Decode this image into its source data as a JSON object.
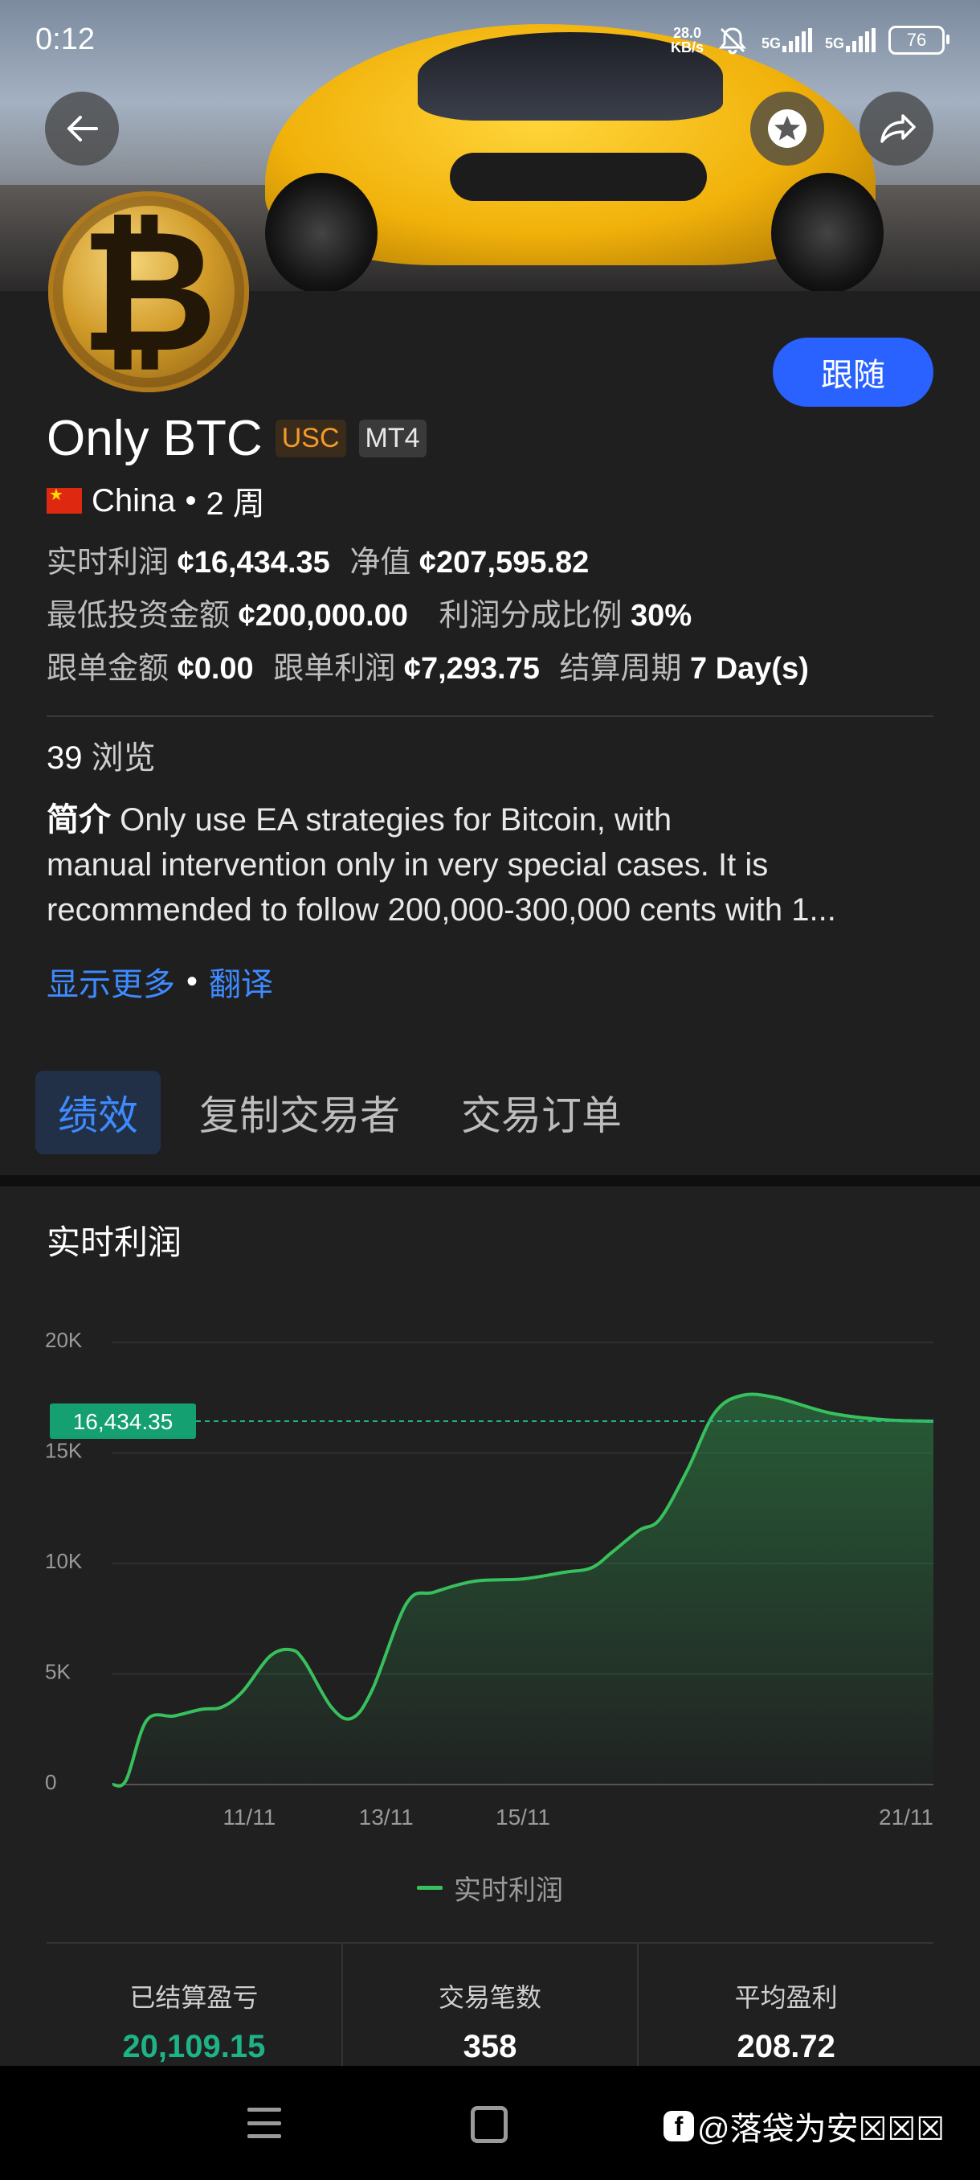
{
  "status_bar": {
    "time": "0:12",
    "net_speed_value": "28.0",
    "net_speed_unit": "KB/s",
    "sim1": "5G",
    "sim2": "5G",
    "battery": "76"
  },
  "header": {
    "icons": [
      "back-arrow-icon",
      "star-icon",
      "share-icon"
    ]
  },
  "profile": {
    "name": "Only BTC",
    "tag_currency": "USC",
    "tag_platform": "MT4",
    "country": "China",
    "separator": "•",
    "duration": "2 周",
    "follow_label": "跟随"
  },
  "stats": {
    "realtime_profit_label": "实时利润",
    "realtime_profit_value": "¢16,434.35",
    "equity_label": "净值",
    "equity_value": "¢207,595.82",
    "min_invest_label": "最低投资金额",
    "min_invest_value": "¢200,000.00",
    "profit_share_label": "利润分成比例",
    "profit_share_value": "30%",
    "copy_amount_label": "跟单金额",
    "copy_amount_value": "¢0.00",
    "copy_profit_label": "跟单利润",
    "copy_profit_value": "¢7,293.75",
    "settle_period_label": "结算周期",
    "settle_period_value": "7 Day(s)"
  },
  "views": {
    "count": "39",
    "label": "浏览"
  },
  "intro": {
    "label": "简介",
    "line1": "Only use EA strategies for Bitcoin, with",
    "line2": "manual intervention only in very special cases. It is",
    "line3": "recommended to follow 200,000-300,000 cents with 1...",
    "show_more": "显示更多",
    "separator": "•",
    "translate": "翻译"
  },
  "tabs": [
    {
      "label": "绩效",
      "active": true
    },
    {
      "label": "复制交易者",
      "active": false
    },
    {
      "label": "交易订单",
      "active": false
    }
  ],
  "chart_section": {
    "title": "实时利润"
  },
  "chart_data": {
    "type": "area",
    "title": "实时利润",
    "series": [
      {
        "name": "实时利润",
        "color": "#38c05d",
        "points": [
          [
            9.0,
            0
          ],
          [
            9.2,
            200
          ],
          [
            9.5,
            2900
          ],
          [
            9.9,
            3100
          ],
          [
            10.3,
            3400
          ],
          [
            10.6,
            3500
          ],
          [
            10.9,
            4200
          ],
          [
            11.3,
            5800
          ],
          [
            11.6,
            6100
          ],
          [
            11.8,
            5600
          ],
          [
            12.2,
            3500
          ],
          [
            12.5,
            3000
          ],
          [
            12.8,
            4300
          ],
          [
            13.3,
            8200
          ],
          [
            13.7,
            8700
          ],
          [
            14.3,
            9200
          ],
          [
            15.0,
            9300
          ],
          [
            15.6,
            9600
          ],
          [
            16.0,
            9800
          ],
          [
            16.3,
            10500
          ],
          [
            16.7,
            11500
          ],
          [
            17.0,
            12000
          ],
          [
            17.4,
            14200
          ],
          [
            17.8,
            16800
          ],
          [
            18.2,
            17600
          ],
          [
            18.7,
            17500
          ],
          [
            19.5,
            16800
          ],
          [
            20.3,
            16500
          ],
          [
            21.0,
            16434.35
          ]
        ]
      }
    ],
    "x_ticks": [
      {
        "value": 11,
        "label": "11/11"
      },
      {
        "value": 13,
        "label": "13/11"
      },
      {
        "value": 15,
        "label": "15/11"
      },
      {
        "value": 21,
        "label": "21/11"
      }
    ],
    "y_ticks": [
      {
        "value": 0,
        "label": "0"
      },
      {
        "value": 5000,
        "label": "5K"
      },
      {
        "value": 10000,
        "label": "10K"
      },
      {
        "value": 15000,
        "label": "15K"
      },
      {
        "value": 20000,
        "label": "20K"
      }
    ],
    "xlim": [
      9.0,
      21.0
    ],
    "ylim": [
      0,
      20000
    ],
    "current_value": 16434.35,
    "current_label": "16,434.35",
    "grid": true,
    "legend_position": "bottom-center"
  },
  "summary": [
    {
      "label": "已结算盈亏",
      "value": "20,109.15",
      "color": "green"
    },
    {
      "label": "交易笔数",
      "value": "358",
      "color": "white"
    },
    {
      "label": "平均盈利",
      "value": "208.72",
      "color": "white"
    }
  ],
  "watermark": {
    "logo": "f",
    "text": "@落袋为安☒☒☒"
  }
}
